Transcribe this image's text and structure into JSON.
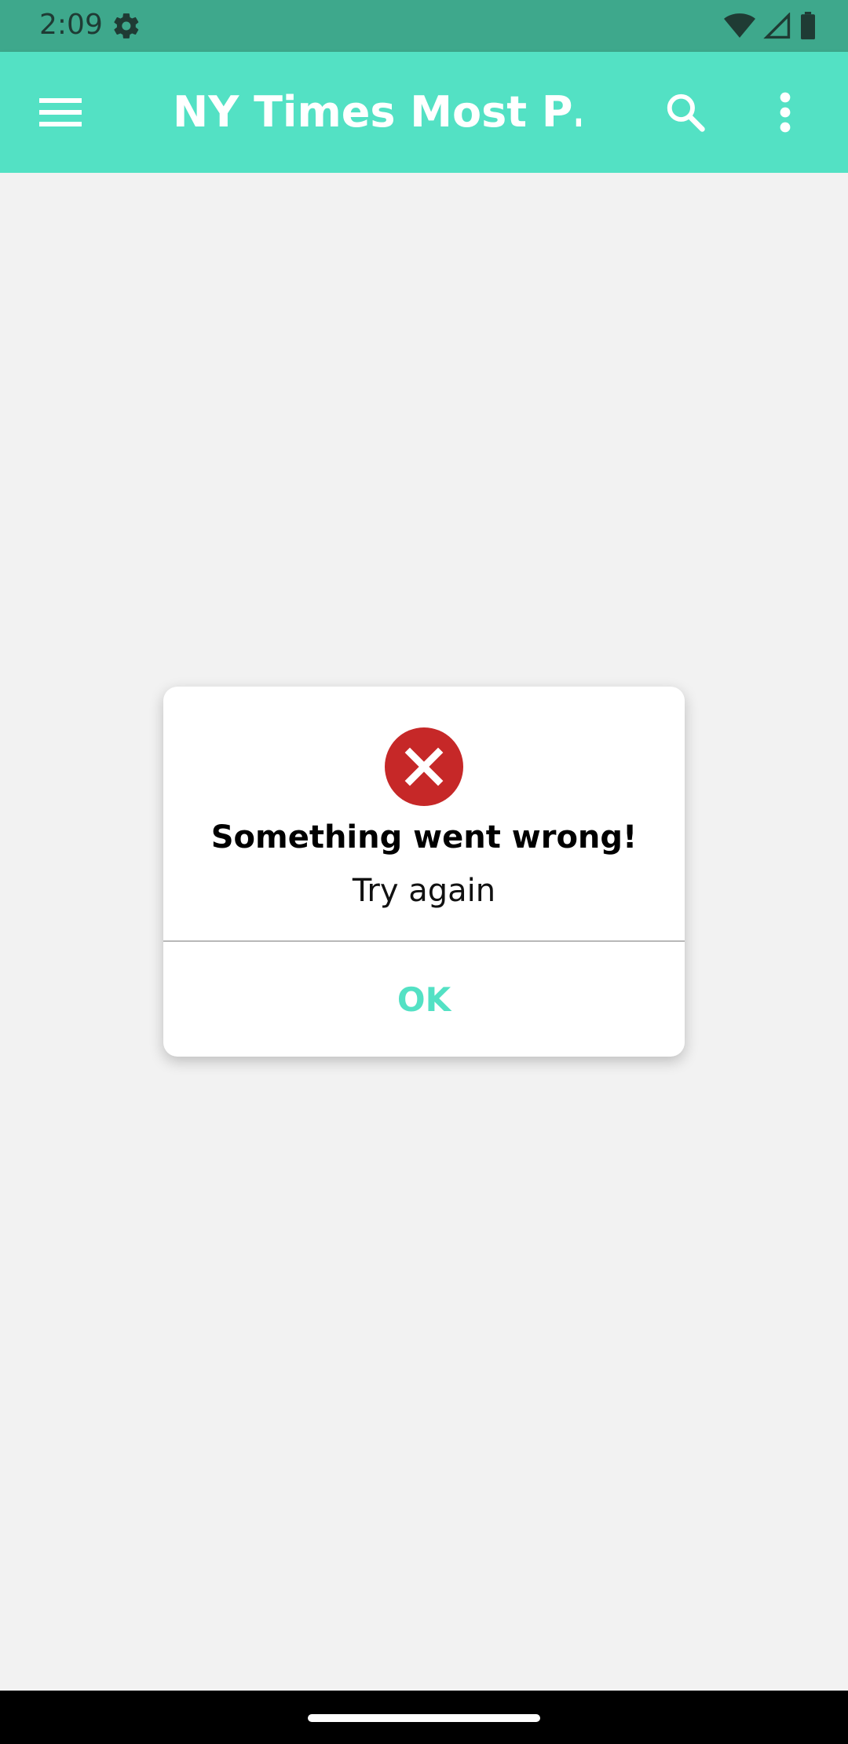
{
  "status_bar": {
    "time": "2:09",
    "icons": [
      "settings-gear-icon",
      "wifi-icon",
      "cell-signal-icon",
      "battery-icon"
    ]
  },
  "app_bar": {
    "title": "NY Times Most P…",
    "menu_icon": "hamburger-menu-icon",
    "search_icon": "search-icon",
    "more_icon": "more-vert-icon",
    "color": "#53e1c4"
  },
  "dialog": {
    "icon": "error-x-icon",
    "icon_color": "#c62828",
    "title": "Something went wrong!",
    "message": "Try again",
    "ok_label": "OK",
    "accent": "#53e1c4"
  },
  "nav_bar": {
    "handle": "home-gesture-handle"
  }
}
